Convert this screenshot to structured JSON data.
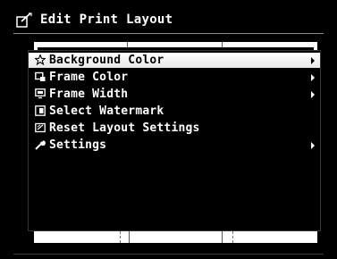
{
  "header": {
    "title": "Edit Print Layout",
    "icon": "edit-layout-icon"
  },
  "menu": {
    "selected_index": 0,
    "items": [
      {
        "label": "Background Color",
        "icon": "star-icon",
        "has_submenu": true
      },
      {
        "label": "Frame Color",
        "icon": "frame-color-icon",
        "has_submenu": true
      },
      {
        "label": "Frame Width",
        "icon": "frame-width-icon",
        "has_submenu": true
      },
      {
        "label": "Select Watermark",
        "icon": "watermark-icon",
        "has_submenu": false
      },
      {
        "label": "Reset Layout Settings",
        "icon": "reset-icon",
        "has_submenu": false
      },
      {
        "label": "Settings",
        "icon": "wrench-icon",
        "has_submenu": true
      }
    ]
  },
  "colors": {
    "background": "#000000",
    "text": "#ffffff",
    "selection": "#ffffff",
    "paper": "#ffffff"
  }
}
